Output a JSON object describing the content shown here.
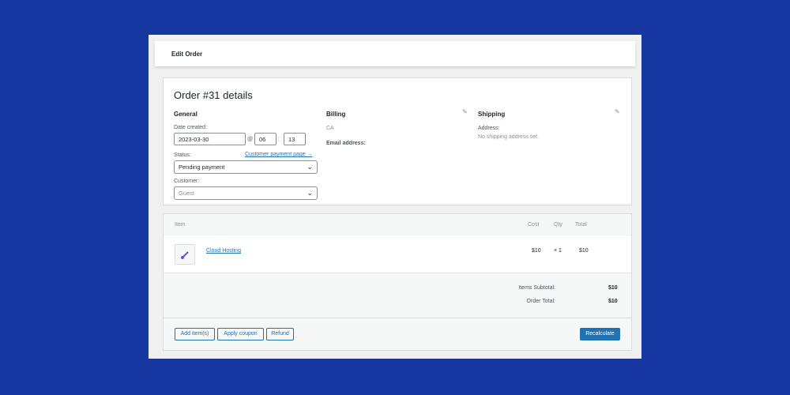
{
  "header": {
    "title": "Edit Order"
  },
  "order": {
    "title": "Order #31 details",
    "general": {
      "heading": "General",
      "date_label": "Date created:",
      "date_value": "2023-03-30",
      "at_symbol": "@",
      "hour": "06",
      "colon": ":",
      "minute": "13",
      "status_label": "Status:",
      "customer_payment_link": "Customer payment page →",
      "status_value": "Pending payment",
      "customer_label": "Customer:",
      "customer_value": "Guest"
    },
    "billing": {
      "heading": "Billing",
      "country": "CA",
      "email_label": "Email address:"
    },
    "shipping": {
      "heading": "Shipping",
      "address_label": "Address:",
      "address_value": "No shipping address set."
    }
  },
  "items": {
    "headers": {
      "item": "Item",
      "cost": "Cost",
      "qty": "Qty",
      "total": "Total"
    },
    "rows": [
      {
        "name": "Cloud Hosting",
        "cost": "$10",
        "qty": "× 1",
        "total": "$10"
      }
    ],
    "subtotal_label": "Items Subtotal:",
    "subtotal_value": "$10",
    "order_total_label": "Order Total:",
    "order_total_value": "$10"
  },
  "actions": {
    "add_items": "Add item(s)",
    "apply_coupon": "Apply coupon",
    "refund": "Refund",
    "recalculate": "Recalculate"
  },
  "colors": {
    "background": "#1637a0",
    "accent": "#2271b1"
  },
  "icons": {
    "edit": "pencil-icon",
    "dropdown": "chevron-down-icon"
  }
}
